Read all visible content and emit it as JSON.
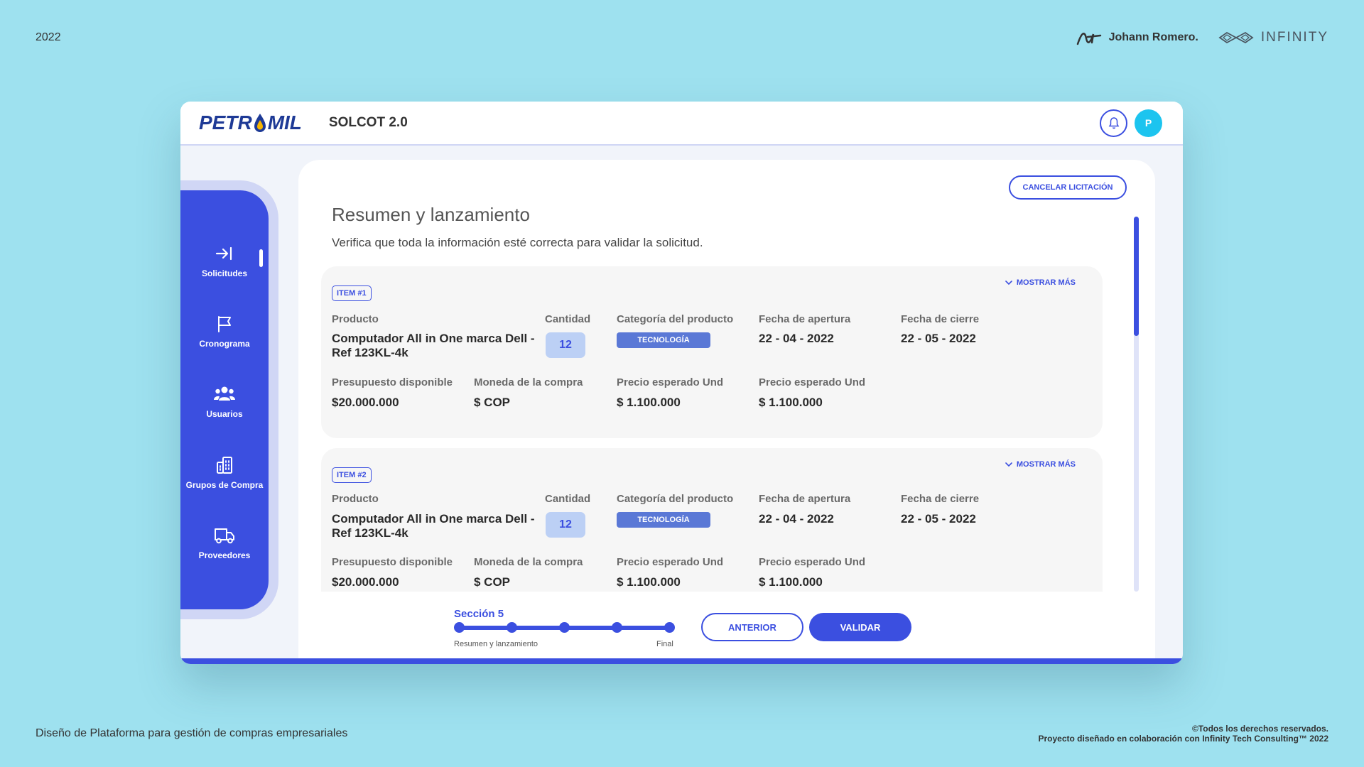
{
  "header": {
    "year": "2022",
    "brand_author": "Johann Romero.",
    "brand_partner": "INFINITY"
  },
  "footer": {
    "left": "Diseño de Plataforma para gestión de compras empresariales",
    "rights": "©Todos los derechos reservados.",
    "project": "Proyecto diseñado en colaboración con Infinity Tech Consulting™ 2022"
  },
  "app": {
    "logo_left": "PETR",
    "logo_right": "MIL",
    "title": "SOLCOT 2.0",
    "avatar": "P",
    "accent": "#3b4fe0",
    "highlight": "#1cc4ef"
  },
  "sidebar": {
    "items": [
      {
        "label": "Solicitudes",
        "icon": "login-arrow-icon"
      },
      {
        "label": "Cronograma",
        "icon": "flag-icon"
      },
      {
        "label": "Usuarios",
        "icon": "users-icon"
      },
      {
        "label": "Grupos de Compra",
        "icon": "building-icon"
      },
      {
        "label": "Proveedores",
        "icon": "truck-icon"
      }
    ]
  },
  "main": {
    "cancel_label": "CANCELAR LICITACIÓN",
    "title": "Resumen y lanzamiento",
    "subtitle": "Verifica que toda la información esté correcta para validar la solicitud.",
    "items": [
      {
        "badge": "ITEM #1",
        "show_more": "MOSTRAR MÁS",
        "label_producto": "Producto",
        "producto": "Computador All in One marca Dell - Ref 123KL-4k",
        "label_cantidad": "Cantidad",
        "cantidad": "12",
        "label_categoria": "Categoría del producto",
        "categoria": "TECNOLOGÍA",
        "label_apertura": "Fecha de apertura",
        "apertura": "22 - 04 - 2022",
        "label_cierre": "Fecha de cierre",
        "cierre": "22 - 05 - 2022",
        "label_presupuesto": "Presupuesto disponible",
        "presupuesto": "$20.000.000",
        "label_moneda": "Moneda de la compra",
        "moneda": "$ COP",
        "label_precio1": "Precio esperado Und",
        "precio1": "$ 1.100.000",
        "label_precio2": "Precio esperado Und",
        "precio2": "$ 1.100.000"
      },
      {
        "badge": "ITEM #2",
        "show_more": "MOSTRAR MÁS",
        "label_producto": "Producto",
        "producto": "Computador All in One marca Dell - Ref 123KL-4k",
        "label_cantidad": "Cantidad",
        "cantidad": "12",
        "label_categoria": "Categoría del producto",
        "categoria": "TECNOLOGÍA",
        "label_apertura": "Fecha de apertura",
        "apertura": "22 - 04 - 2022",
        "label_cierre": "Fecha de cierre",
        "cierre": "22 - 05 - 2022",
        "label_presupuesto": "Presupuesto disponible",
        "presupuesto": "$20.000.000",
        "label_moneda": "Moneda de la compra",
        "moneda": "$ COP",
        "label_precio1": "Precio esperado Und",
        "precio1": "$ 1.100.000",
        "label_precio2": "Precio esperado Und",
        "precio2": "$ 1.100.000"
      }
    ]
  },
  "stepper": {
    "title": "Sección 5",
    "start_label": "Resumen y lanzamiento",
    "end_label": "Final",
    "total_steps": 5,
    "current_step": 5
  },
  "actions": {
    "prev_label": "ANTERIOR",
    "validate_label": "VALIDAR"
  }
}
